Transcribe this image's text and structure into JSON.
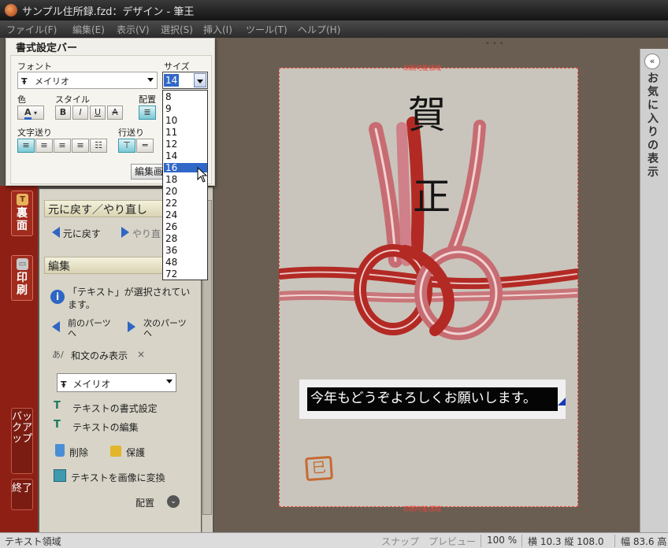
{
  "window": {
    "title": "サンプル住所録.fzd：デザイン - 筆王"
  },
  "menu": {
    "items": [
      "ファイル(F)",
      "編集(E)",
      "表示(V)",
      "選択(S)",
      "挿入(I)",
      "ツール(T)",
      "ヘルプ(H)"
    ]
  },
  "format_bar": {
    "title": "書式設定バー",
    "font_label": "フォント",
    "font_value": "メイリオ",
    "size_label": "サイズ",
    "size_value": "14",
    "color_label": "色",
    "style_label": "スタイル",
    "align_label": "配置",
    "char_spacing_label": "文字送り",
    "line_spacing_label": "行送り",
    "edit_button": "編集画",
    "size_options": [
      "8",
      "9",
      "10",
      "11",
      "12",
      "14",
      "16",
      "18",
      "20",
      "22",
      "24",
      "26",
      "28",
      "36",
      "48",
      "72"
    ],
    "highlighted_option": "16",
    "style_buttons": [
      "B",
      "I",
      "U",
      "A"
    ]
  },
  "side_tabs": {
    "back": "裏面",
    "print": "印刷",
    "backup": "バックアップ",
    "exit": "終了"
  },
  "task_panel": {
    "undo_section": "元に戻す／やり直し",
    "undo": "元に戻す",
    "redo": "やり直",
    "edit_section": "編集",
    "info_text_1": "「テキスト」が選択されてい",
    "info_text_2": "ます。",
    "prev_part_1": "前のパーツ",
    "prev_part_2": "へ",
    "next_part_1": "次のパーツ",
    "next_part_2": "へ",
    "japanese_only": "和文のみ表示",
    "close_mark": "×",
    "font_value": "メイリオ",
    "text_format": "テキストの書式設定",
    "text_edit": "テキストの編集",
    "delete": "削除",
    "protect": "保護",
    "to_image": "テキストを画像に変換",
    "layout": "配置"
  },
  "right_dock": {
    "title": "お気に入りの表示",
    "collapse_glyph": "«"
  },
  "card": {
    "guide_top": "印刷可能領域",
    "guide_bottom": "印刷可能領域",
    "kanji_1": "賀",
    "kanji_2": "正",
    "greeting": "今年もどうぞよろしくお願いします。",
    "stamp": "巳"
  },
  "status_bar": {
    "mode": "テキスト領域",
    "snap": "スナップ",
    "preview": "プレビュー",
    "zoom": "100 %",
    "position": "横 10.3 縦 108.0",
    "width": "幅 83.6 高"
  },
  "colors": {
    "accent_blue": "#3168c8",
    "tab_red": "#8e1f14",
    "cord_red": "#b32a24",
    "guide_red": "#e8463a"
  }
}
